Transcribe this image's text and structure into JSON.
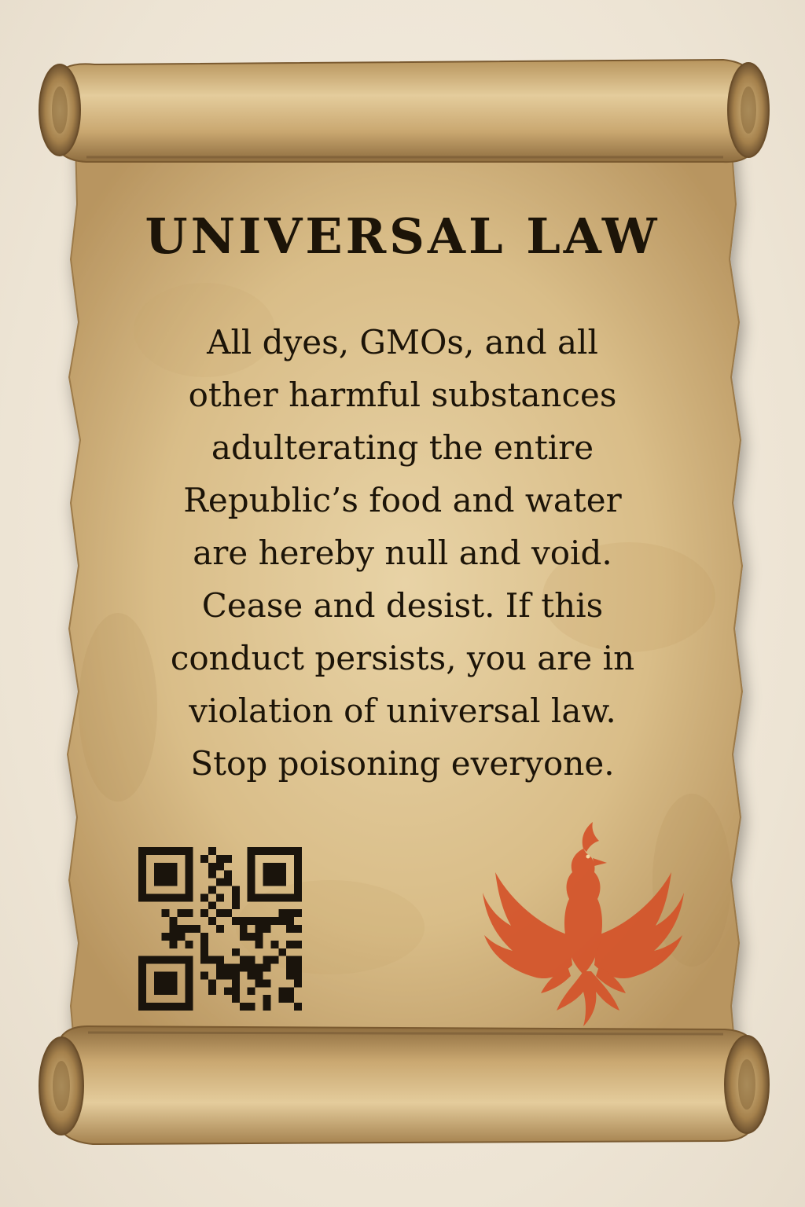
{
  "scroll": {
    "title": "UNIVERSAL LAW",
    "body_lines": [
      "All dyes, GMOs, and all",
      "other harmful substances",
      "adulterating the entire",
      "Republic’s food and water",
      "are hereby null and void.",
      "Cease and desist. If this",
      "conduct persists, you are in",
      "violation of universal law.",
      "Stop poisoning everyone."
    ],
    "qr_icon": "qr-code-icon",
    "emblem_icon": "phoenix-icon"
  },
  "colors": {
    "parchment": "#d9bf8c",
    "ink": "#1c1408",
    "phoenix": "#d4532a"
  }
}
